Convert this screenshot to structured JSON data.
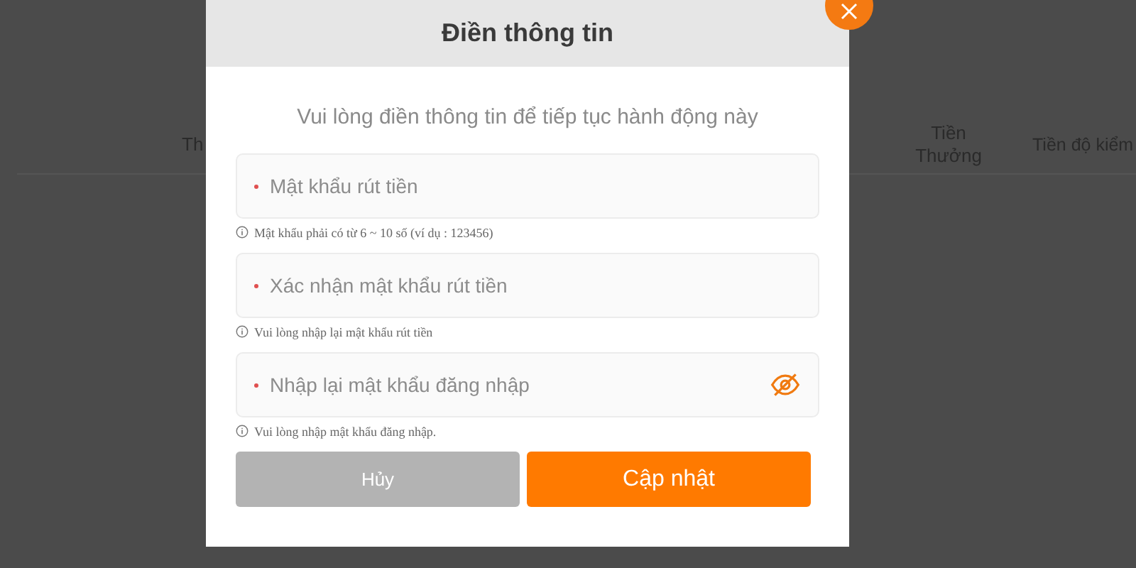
{
  "background_table": {
    "columns": [
      "Th",
      "Tiền Thưởng",
      "Tiền độ kiểm"
    ]
  },
  "dialog": {
    "title": "Điền thông tin",
    "subtitle": "Vui lòng điền thông tin để tiếp tục hành động này",
    "fields": [
      {
        "kind": "text",
        "required": true,
        "placeholder": "Mật khẩu rút tiền",
        "hint": "Mật khẩu phải có từ 6 ~ 10 số (ví dụ : 123456)"
      },
      {
        "kind": "text",
        "required": true,
        "placeholder": "Xác nhận mật khẩu rút tiền",
        "hint": "Vui lòng nhập lại mật khẩu rút tiền"
      },
      {
        "kind": "reveal",
        "required": true,
        "placeholder": "Nhập lại mật khẩu đăng nhập",
        "hint": "Vui lòng nhập mật khẩu đăng nhập."
      }
    ],
    "buttons": [
      {
        "kind": "secondary",
        "label": "Hủy"
      },
      {
        "kind": "primary",
        "label": "Cập nhật"
      }
    ]
  }
}
